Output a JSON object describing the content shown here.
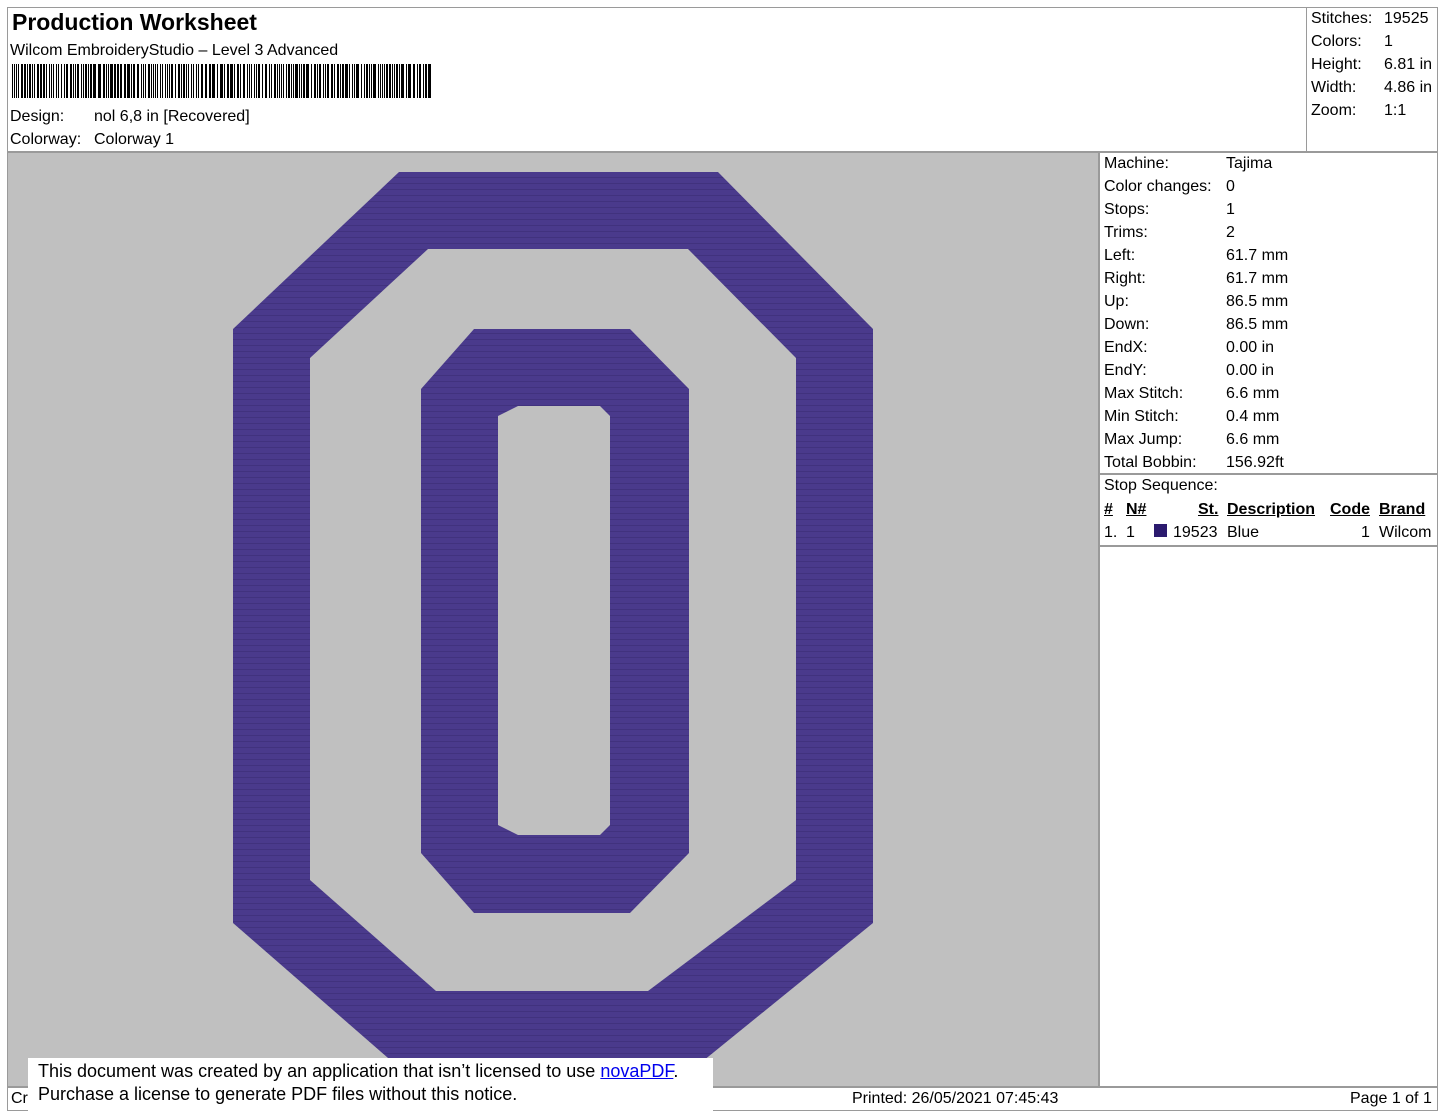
{
  "header": {
    "title": "Production Worksheet",
    "software": "Wilcom EmbroideryStudio – Level 3 Advanced",
    "design_label": "Design:",
    "design_value": "nol 6,8 in [Recovered]",
    "colorway_label": "Colorway:",
    "colorway_value": "Colorway 1"
  },
  "stats": [
    {
      "label": "Stitches:",
      "value": "19525"
    },
    {
      "label": "Colors:",
      "value": "1"
    },
    {
      "label": "Height:",
      "value": "6.81 in"
    },
    {
      "label": "Width:",
      "value": "4.86 in"
    },
    {
      "label": "Zoom:",
      "value": "1:1"
    }
  ],
  "details": [
    {
      "label": "Machine:",
      "value": "Tajima"
    },
    {
      "label": "Color changes:",
      "value": "0"
    },
    {
      "label": "Stops:",
      "value": "1"
    },
    {
      "label": "Trims:",
      "value": "2"
    },
    {
      "label": "Left:",
      "value": "61.7 mm"
    },
    {
      "label": "Right:",
      "value": "61.7 mm"
    },
    {
      "label": "Up:",
      "value": "86.5 mm"
    },
    {
      "label": "Down:",
      "value": "86.5 mm"
    },
    {
      "label": "EndX:",
      "value": "0.00 in"
    },
    {
      "label": "EndY:",
      "value": "0.00 in"
    },
    {
      "label": "Max Stitch:",
      "value": "6.6 mm"
    },
    {
      "label": "Min Stitch:",
      "value": "0.4 mm"
    },
    {
      "label": "Max Jump:",
      "value": "6.6 mm"
    },
    {
      "label": "Total Bobbin:",
      "value": "156.92ft"
    }
  ],
  "stop_sequence": {
    "title": "Stop Sequence:",
    "headers": {
      "num": "#",
      "needle": "N#",
      "stitches": "St.",
      "description": "Description",
      "code": "Code",
      "brand": "Brand"
    },
    "rows": [
      {
        "num": "1.",
        "needle": "1",
        "color": "#2b1a6e",
        "stitches": "19523",
        "description": "Blue",
        "code": "1",
        "brand": "Wilcom"
      }
    ]
  },
  "design_color": "#4a3a8c",
  "preview_background": "#c0c0c0",
  "footer": {
    "left_fragment": "Cr",
    "printed": "Printed: 26/05/2021 07:45:43",
    "page": "Page 1 of 1"
  },
  "notice": {
    "line1_prefix": "This document was created by an application that isn’t licensed to use ",
    "link": "novaPDF",
    "line1_suffix": ".",
    "line2": "Purchase a license to generate PDF files without this notice."
  }
}
